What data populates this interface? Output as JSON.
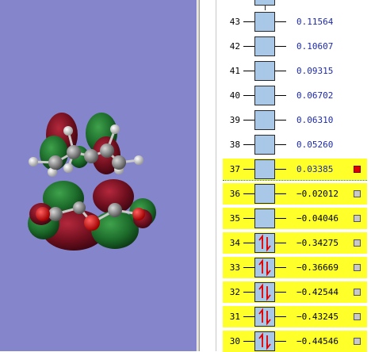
{
  "orbitals": [
    {
      "index": "43",
      "energy": "0.11564",
      "occupied": false,
      "highlighted": false
    },
    {
      "index": "42",
      "energy": "0.10607",
      "occupied": false,
      "highlighted": false
    },
    {
      "index": "41",
      "energy": "0.09315",
      "occupied": false,
      "highlighted": false
    },
    {
      "index": "40",
      "energy": "0.06702",
      "occupied": false,
      "highlighted": false
    },
    {
      "index": "39",
      "energy": "0.06310",
      "occupied": false,
      "highlighted": false
    },
    {
      "index": "38",
      "energy": "0.05260",
      "occupied": false,
      "highlighted": false
    },
    {
      "index": "37",
      "energy": "0.03385",
      "occupied": false,
      "highlighted": true,
      "selected": true
    },
    {
      "index": "36",
      "energy": "−0.02012",
      "occupied": false,
      "highlighted": true
    },
    {
      "index": "35",
      "energy": "−0.04046",
      "occupied": false,
      "highlighted": true
    },
    {
      "index": "34",
      "energy": "−0.34275",
      "occupied": true,
      "highlighted": true
    },
    {
      "index": "33",
      "energy": "−0.36669",
      "occupied": true,
      "highlighted": true
    },
    {
      "index": "32",
      "energy": "−0.42544",
      "occupied": true,
      "highlighted": true
    },
    {
      "index": "31",
      "energy": "−0.43245",
      "occupied": true,
      "highlighted": true
    },
    {
      "index": "30",
      "energy": "−0.44546",
      "occupied": true,
      "highlighted": true
    }
  ],
  "colors": {
    "viewer_bg": "#8585cc",
    "highlight": "#ffff2a",
    "orbital_box": "#a9c7e6",
    "positive_energy": "#1c2aa8",
    "spin_arrows": "#e00000",
    "lobe_red": "#6e0f1e",
    "lobe_green": "#1c6a2a"
  },
  "icons": {
    "selected_marker": "red-square-icon",
    "unselected_marker": "gray-square-icon",
    "electron_pair": "up-down-arrows-icon"
  }
}
